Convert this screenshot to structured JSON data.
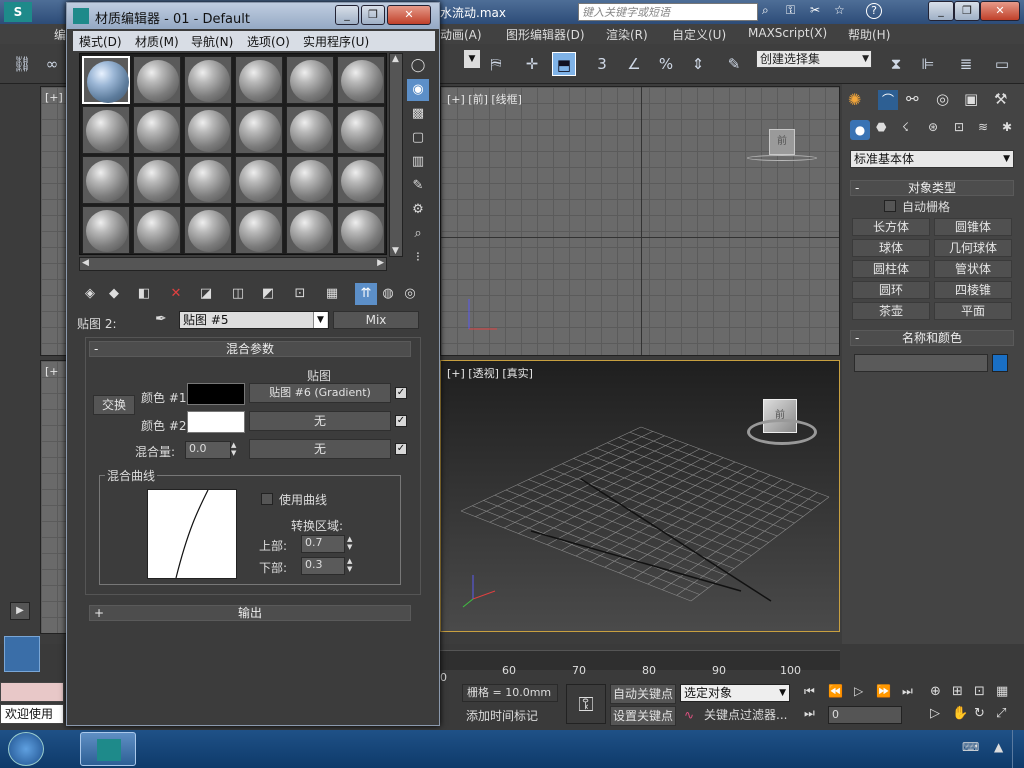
{
  "app": {
    "file_name_partial": "水流动.max",
    "search_placeholder": "键入关键字或短语",
    "menu": [
      "动画(A)",
      "图形编辑器(D)",
      "渲染(R)",
      "自定义(U)",
      "MAXScript(X)",
      "帮助(H)"
    ],
    "menu_partial_left": "编",
    "toolbar": {
      "selection_set": "创建选择集",
      "snap_3": "3",
      "percent_icon": "%"
    }
  },
  "viewports": {
    "front_label": "[+] [前] [线框]",
    "top_left_label": "[+]",
    "left_label": "[+",
    "persp_label": "[+] [透视] [真实]"
  },
  "command_panel": {
    "dropdown": "标准基本体",
    "object_type_header": "对象类型",
    "auto_grid": "自动栅格",
    "buttons": [
      "长方体",
      "圆锥体",
      "球体",
      "几何球体",
      "圆柱体",
      "管状体",
      "圆环",
      "四棱锥",
      "茶壶",
      "平面"
    ],
    "name_color_header": "名称和颜色",
    "name_value": "",
    "object_color": "#1a6fc4"
  },
  "timeline": {
    "ticks": [
      "0",
      "60",
      "70",
      "80",
      "90",
      "100"
    ]
  },
  "status": {
    "welcome": "欢迎使用",
    "grid": "栅格 = 10.0mm",
    "add_time_tag": "添加时间标记",
    "auto_key": "自动关键点",
    "set_key": "设置关键点",
    "selected_object": "选定对象",
    "key_filter": "关键点过滤器...",
    "frame_value": "0"
  },
  "material_editor": {
    "title": "材质编辑器 - 01 - Default",
    "menu": [
      "模式(D)",
      "材质(M)",
      "导航(N)",
      "选项(O)",
      "实用程序(U)"
    ],
    "map_label": "贴图 2:",
    "map_name": "贴图 #5",
    "map_type": "Mix",
    "rollout_mix": "混合参数",
    "map_column": "贴图",
    "swap": "交换",
    "color1_label": "颜色 #1",
    "color1": "#000000",
    "color1_map": "贴图 #6 (Gradient)",
    "color2_label": "颜色 #2",
    "color2": "#ffffff",
    "color2_map": "无",
    "mix_amount_label": "混合量:",
    "mix_amount": "0.0",
    "mix_map": "无",
    "mix_curve_group": "混合曲线",
    "use_curve": "使用曲线",
    "transition_zone": "转换区域:",
    "upper_label": "上部:",
    "upper": "0.7",
    "lower_label": "下部:",
    "lower": "0.3",
    "rollout_output": "输出"
  }
}
